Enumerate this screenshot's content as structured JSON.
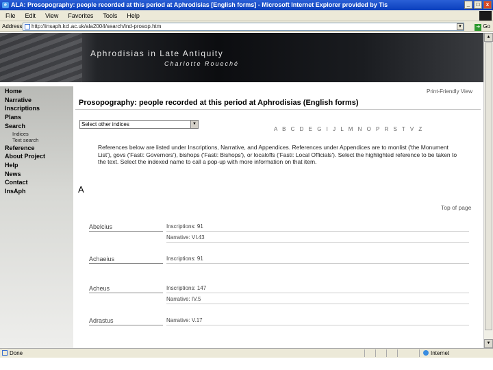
{
  "window": {
    "title": "ALA: Prosopography: people recorded at this period at Aphrodisias [English forms] - Microsoft Internet Explorer provided by Tis",
    "app_icon": "ie-icon",
    "controls": [
      "_",
      "□",
      "x"
    ]
  },
  "menu": [
    "File",
    "Edit",
    "View",
    "Favorites",
    "Tools",
    "Help"
  ],
  "address": {
    "label": "Address",
    "url": "http://insaph.kcl.ac.uk/ala2004/search/ind-prosop.htm",
    "go_label": "Go"
  },
  "banner": {
    "title": "Aphrodisias in Late Antiquity",
    "author": "Charlotte Roueché"
  },
  "sidebar": {
    "items": [
      {
        "label": "Home"
      },
      {
        "label": "Narrative"
      },
      {
        "label": "Inscriptions"
      },
      {
        "label": "Plans"
      },
      {
        "label": "Search"
      },
      {
        "label": "Indices",
        "sub": true
      },
      {
        "label": "Text search",
        "sub": true
      },
      {
        "label": "Reference"
      },
      {
        "label": "About Project"
      },
      {
        "label": "Help"
      },
      {
        "label": "News"
      },
      {
        "label": "Contact"
      },
      {
        "label": "InsAph"
      }
    ]
  },
  "main": {
    "print_link": "Print-Friendly View",
    "page_title": "Prosopography: people recorded at this period at Aphrodisias (English forms)",
    "index_select": "Select other indices",
    "letters": "A B C D E G I J L M N O P R S T V Z",
    "intro": "References below are listed under Inscriptions, Narrative, and Appendices. References under Appendices are to monlist ('the Monument List'), govs ('Fasti: Governors'), bishops ('Fasti: Bishops'), or localoffs ('Fasti: Local Officials'). Select the highlighted reference to be taken to the text. Select the indexed name to call a pop-up with more information on that item.",
    "section_letter": "A",
    "top_link": "Top of page",
    "entries": [
      {
        "name": "Abelcius",
        "refs": [
          "Inscriptions: 91",
          "Narrative: VI.43"
        ]
      },
      {
        "name": "Achaeius",
        "refs": [
          "Inscriptions: 91"
        ]
      },
      {
        "name": "Acheus",
        "refs": [
          "Inscriptions: 147",
          "Narrative: IV.5"
        ]
      },
      {
        "name": "Adrastus",
        "refs": [
          "Narrative: V.17"
        ]
      }
    ]
  },
  "status": {
    "text": "Done",
    "zone": "Internet"
  }
}
